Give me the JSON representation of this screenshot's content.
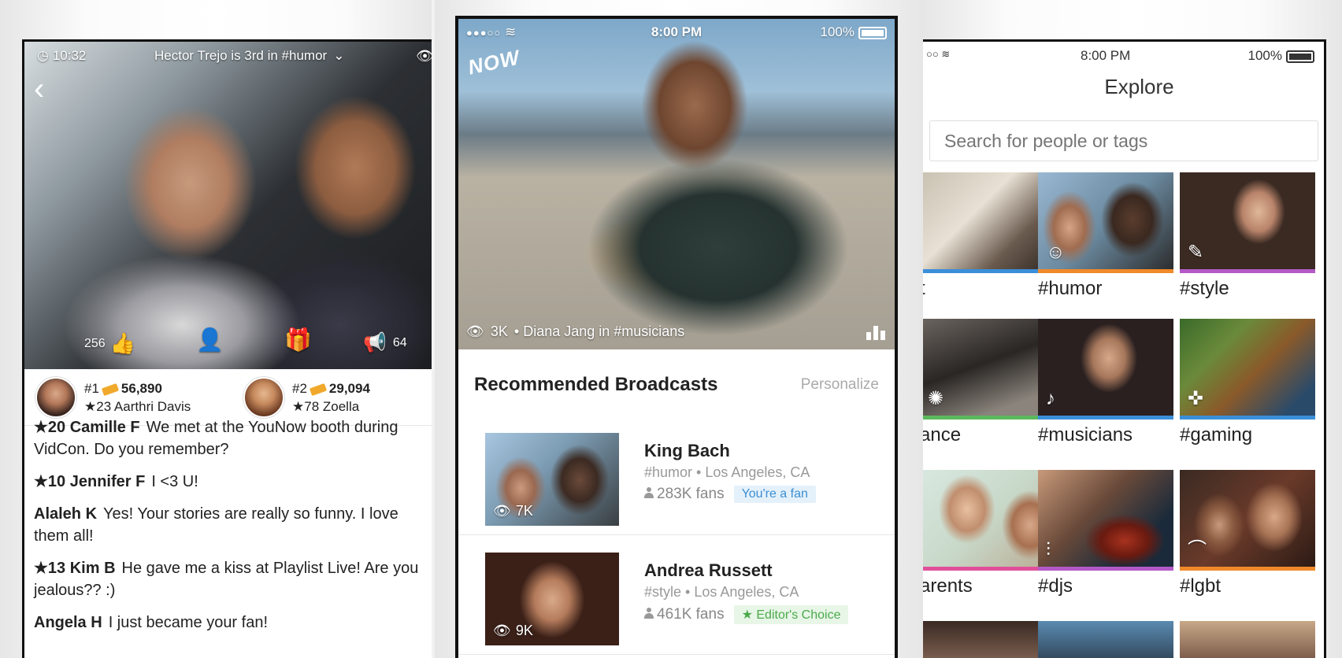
{
  "left": {
    "time": "10:32",
    "title": "Hector Trejo is 3rd in #humor",
    "likes": "256",
    "shares": "64",
    "rank": [
      {
        "label": "#1",
        "coins": "56,890",
        "user": "★23 Aarthri Davis"
      },
      {
        "label": "#2",
        "coins": "29,094",
        "user": "★78 Zoella"
      }
    ],
    "chat": [
      {
        "who": "★20 Camille F",
        "text": "We met at the YouNow booth during VidCon. Do you remember?"
      },
      {
        "who": "★10 Jennifer F",
        "text": "I <3 U!"
      },
      {
        "who": "Alaleh K",
        "text": "Yes! Your stories are really so funny. I love them all!"
      },
      {
        "who": "★13 Kim B",
        "text": "He gave me a kiss at Playlist Live! Are you jealous?? :)"
      },
      {
        "who": "Angela H",
        "text": "I just became your fan!"
      }
    ]
  },
  "middle": {
    "status": {
      "signal": "●●●○○",
      "time": "8:00 PM",
      "battery": "100%"
    },
    "now_badge": "NOW",
    "caption_views": "3K",
    "caption_text": "• Diana Jang in #musicians",
    "section_title": "Recommended Broadcasts",
    "section_link": "Personalize",
    "broadcasts": [
      {
        "name": "King Bach",
        "meta": "#humor • Los Angeles, CA",
        "fans": "283K fans",
        "tag": "You're a fan",
        "views": "7K"
      },
      {
        "name": "Andrea Russett",
        "meta": "#style • Los Angeles, CA",
        "fans": "461K fans",
        "tag": "★ Editor's Choice",
        "views": "9K"
      }
    ]
  },
  "right": {
    "status": {
      "signal": "○○",
      "time": "8:00 PM",
      "battery": "100%"
    },
    "title": "Explore",
    "search_placeholder": "Search for people or tags",
    "tiles": [
      {
        "label": "t"
      },
      {
        "label": "#humor"
      },
      {
        "label": "#style"
      },
      {
        "label": "ance"
      },
      {
        "label": "#musicians"
      },
      {
        "label": "#gaming"
      },
      {
        "label": "arents"
      },
      {
        "label": "#djs"
      },
      {
        "label": "#lgbt"
      }
    ]
  },
  "colors": {
    "fan_tag": "#3d8fd1",
    "editor_tag": "#4aaa4a",
    "stripe_blue": "#3a8fd8",
    "stripe_orange": "#f08a2a",
    "stripe_purple": "#b45ac8",
    "stripe_green": "#5cb85c",
    "stripe_pink": "#e0509a"
  }
}
